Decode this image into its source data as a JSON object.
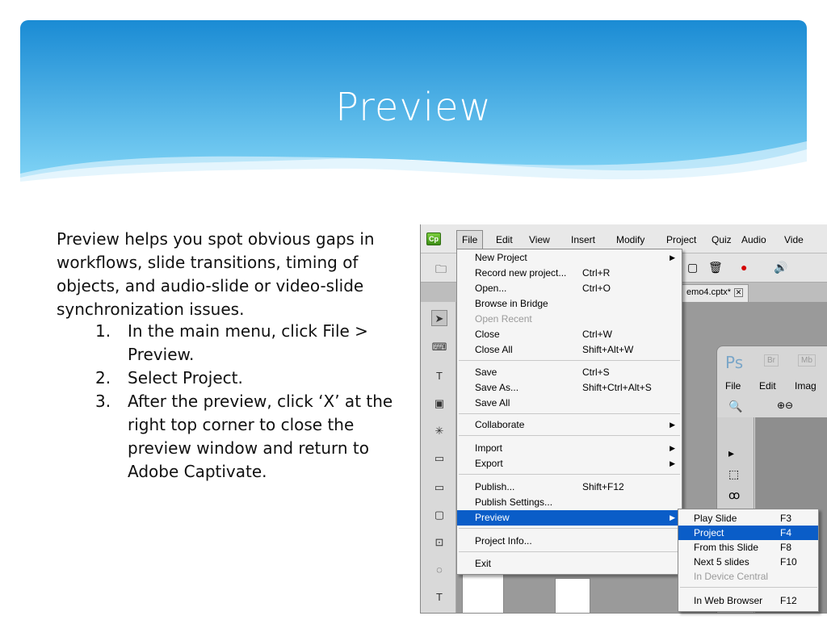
{
  "slide": {
    "title": "Preview",
    "intro": "Preview helps you spot obvious gaps in workflows, slide transitions, timing of objects, and audio-slide or video-slide synchronization issues.",
    "steps": [
      {
        "num": "1.",
        "text": "In the main menu, click File > Preview."
      },
      {
        "num": "2.",
        "text": "Select Project."
      },
      {
        "num": "3.",
        "text": "After the preview, click ‘X’ at the right top corner to close the preview window and return to Adobe Captivate."
      }
    ],
    "colors": {
      "header_top": "#1a8bd4",
      "header_bottom": "#7fd3f5",
      "menu_highlight": "#0a5dc8"
    }
  },
  "app": {
    "logo": "Cp",
    "menubar": [
      "File",
      "Edit",
      "View",
      "Insert",
      "Modify",
      "Project",
      "Quiz",
      "Audio",
      "Vide"
    ],
    "doc_tab": "emo4.cptx*",
    "doc_tab_close": "✕"
  },
  "file_menu": {
    "items": [
      {
        "label": "New Project",
        "shortcut": "",
        "submenu": true
      },
      {
        "label": "Record new project...",
        "shortcut": "Ctrl+R"
      },
      {
        "label": "Open...",
        "shortcut": "Ctrl+O"
      },
      {
        "label": "Browse in Bridge",
        "shortcut": ""
      },
      {
        "label": "Open Recent",
        "shortcut": "",
        "disabled": true
      },
      {
        "label": "Close",
        "shortcut": "Ctrl+W"
      },
      {
        "label": "Close All",
        "shortcut": "Shift+Alt+W"
      },
      {
        "label": "Save",
        "shortcut": "Ctrl+S"
      },
      {
        "label": "Save As...",
        "shortcut": "Shift+Ctrl+Alt+S"
      },
      {
        "label": "Save All",
        "shortcut": ""
      },
      {
        "label": "Collaborate",
        "shortcut": "",
        "submenu": true
      },
      {
        "label": "Import",
        "shortcut": "",
        "submenu": true
      },
      {
        "label": "Export",
        "shortcut": "",
        "submenu": true
      },
      {
        "label": "Publish...",
        "shortcut": "Shift+F12"
      },
      {
        "label": "Publish Settings...",
        "shortcut": ""
      },
      {
        "label": "Preview",
        "shortcut": "",
        "submenu": true,
        "highlighted": true
      },
      {
        "label": "Project Info...",
        "shortcut": ""
      },
      {
        "label": "Exit",
        "shortcut": ""
      }
    ]
  },
  "preview_submenu": {
    "items": [
      {
        "label": "Play Slide",
        "shortcut": "F3"
      },
      {
        "label": "Project",
        "shortcut": "F4",
        "highlighted": true
      },
      {
        "label": "From this Slide",
        "shortcut": "F8"
      },
      {
        "label": "Next 5 slides",
        "shortcut": "F10"
      },
      {
        "label": "In Device Central",
        "shortcut": "",
        "disabled": true
      },
      {
        "label": "In Web Browser",
        "shortcut": "F12"
      }
    ]
  },
  "photoshop": {
    "logo": "Ps",
    "badges": [
      "Br",
      "Mb"
    ],
    "menu": [
      "File",
      "Edit",
      "Imag"
    ]
  }
}
